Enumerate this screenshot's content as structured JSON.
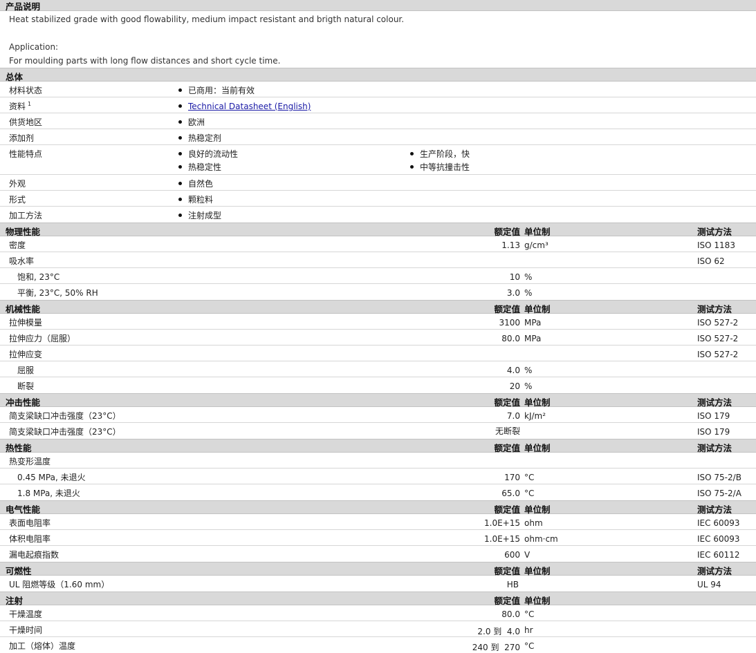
{
  "description": {
    "title": "产品说明",
    "text": "Heat stabilized grade with good flowability, medium impact resistant and brigth natural colour.",
    "application_label": "Application:",
    "application_text": "For moulding parts with long flow distances and short cycle time."
  },
  "general": {
    "title": "总体",
    "rows": [
      {
        "label": "材料状态",
        "items": [
          "已商用：当前有效"
        ]
      },
      {
        "label": "资料",
        "sup": "1",
        "link": "Technical Datasheet (English)"
      },
      {
        "label": "供货地区",
        "items": [
          "欧洲"
        ]
      },
      {
        "label": "添加剂",
        "items": [
          "热稳定剂"
        ]
      },
      {
        "label": "性能特点",
        "col1": [
          "良好的流动性",
          "热稳定性"
        ],
        "col2": [
          "生产阶段，快",
          "中等抗撞击性"
        ]
      },
      {
        "label": "外观",
        "items": [
          "自然色"
        ]
      },
      {
        "label": "形式",
        "items": [
          "颗粒料"
        ]
      },
      {
        "label": "加工方法",
        "items": [
          "注射成型"
        ]
      }
    ]
  },
  "headers": {
    "nominal": "额定值",
    "unit": "单位制",
    "test": "测试方法"
  },
  "physical": {
    "title": "物理性能",
    "rows": [
      {
        "label": "密度",
        "value": "1.13",
        "unit": "g/cm³",
        "test": "ISO 1183"
      },
      {
        "label": "吸水率",
        "value": "",
        "unit": "",
        "test": "ISO 62"
      },
      {
        "label": "饱和, 23°C",
        "indent": true,
        "value": "10",
        "unit": "%",
        "test": ""
      },
      {
        "label": "平衡, 23°C, 50% RH",
        "indent": true,
        "value": "3.0",
        "unit": "%",
        "test": ""
      }
    ]
  },
  "mechanical": {
    "title": "机械性能",
    "rows": [
      {
        "label": "拉伸模量",
        "value": "3100",
        "unit": "MPa",
        "test": "ISO 527-2"
      },
      {
        "label": "拉伸应力（屈服）",
        "value": "80.0",
        "unit": "MPa",
        "test": "ISO 527-2"
      },
      {
        "label": "拉伸应变",
        "value": "",
        "unit": "",
        "test": "ISO 527-2"
      },
      {
        "label": "屈服",
        "indent": true,
        "value": "4.0",
        "unit": "%",
        "test": ""
      },
      {
        "label": "断裂",
        "indent": true,
        "value": "20",
        "unit": "%",
        "test": ""
      }
    ]
  },
  "impact": {
    "title": "冲击性能",
    "rows": [
      {
        "label": "简支梁缺口冲击强度（23°C）",
        "value": "7.0",
        "unit": "kJ/m²",
        "test": "ISO 179"
      },
      {
        "label": "简支梁缺口冲击强度（23°C）",
        "value": "无断裂",
        "unit": "",
        "test": "ISO 179"
      }
    ]
  },
  "thermal": {
    "title": "热性能",
    "rows": [
      {
        "label": "热变形温度",
        "value": "",
        "unit": "",
        "test": ""
      },
      {
        "label": "0.45 MPa, 未退火",
        "indent": true,
        "value": "170",
        "unit": "°C",
        "test": "ISO 75-2/B"
      },
      {
        "label": "1.8 MPa, 未退火",
        "indent": true,
        "value": "65.0",
        "unit": "°C",
        "test": "ISO 75-2/A"
      }
    ]
  },
  "electrical": {
    "title": "电气性能",
    "rows": [
      {
        "label": "表面电阻率",
        "value": "1.0E+15",
        "unit": "ohm",
        "test": "IEC 60093"
      },
      {
        "label": "体积电阻率",
        "value": "1.0E+15",
        "unit": "ohm·cm",
        "test": "IEC 60093"
      },
      {
        "label": "漏电起痕指数",
        "value": "600",
        "unit": "V",
        "test": "IEC 60112"
      }
    ]
  },
  "flammability": {
    "title": "可燃性",
    "rows": [
      {
        "label": "UL 阻燃等级（1.60 mm）",
        "value": "HB",
        "unit": "",
        "test": "UL 94"
      }
    ]
  },
  "injection": {
    "title": "注射",
    "rows": [
      {
        "label": "干燥温度",
        "value": "80.0",
        "unit": "°C",
        "test": ""
      },
      {
        "label": "干燥时间",
        "value": "2.0 到  4.0",
        "unit": "hr",
        "test": ""
      },
      {
        "label": "加工（熔体）温度",
        "value": "240 到  270",
        "unit": "°C",
        "test": ""
      }
    ]
  }
}
